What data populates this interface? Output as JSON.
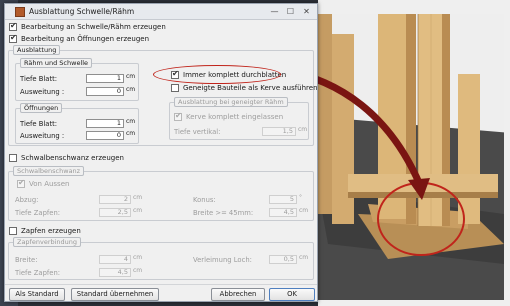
{
  "window": {
    "title": "Ausblattung Schwelle/Rähm",
    "minimize": "—",
    "maximize": "☐",
    "close": "✕"
  },
  "top": {
    "bearbeitung_schwelle": "Bearbeitung an Schwelle/Rähm erzeugen",
    "bearbeitung_oeffnungen": "Bearbeitung an Öffnungen erzeugen"
  },
  "ausblattung": {
    "title": "Ausblattung",
    "raehm": {
      "title": "Rähm und Schwelle",
      "tiefe_label": "Tiefe Blatt:",
      "tiefe_value": "1",
      "ausweitung_label": "Ausweitung :",
      "ausweitung_value": "0",
      "unit": "cm"
    },
    "oeffnungen": {
      "title": "Öffnungen",
      "tiefe_label": "Tiefe Blatt:",
      "tiefe_value": "1",
      "ausweitung_label": "Ausweitung :",
      "ausweitung_value": "0",
      "unit": "cm"
    },
    "immer_komplett": "Immer komplett durchblatten",
    "geneigte_bauteile": "Geneigte Bauteile als Kerve ausführen",
    "geneigter_raehm": {
      "title": "Ausblattung bei geneigter Rähm",
      "kerve_label": "Kerve komplett eingelassen",
      "tiefe_label": "Tiefe vertikal:",
      "tiefe_value": "1,5",
      "unit": "cm"
    }
  },
  "schwalbenschwanz": {
    "checkbox": "Schwalbenschwanz erzeugen",
    "group": "Schwalbenschwanz",
    "von_aussen": "Von Aussen",
    "abzug_label": "Abzug:",
    "abzug_value": "2",
    "konus_label": "Konus:",
    "konus_value": "5",
    "tiefe_zapfen_label": "Tiefe Zapfen:",
    "tiefe_zapfen_value": "2,5",
    "breite_label": "Breite >= 45mm:",
    "breite_value": "4,5",
    "unit_cm": "cm",
    "unit_deg": "°"
  },
  "zapfen": {
    "checkbox": "Zapfen erzeugen",
    "group": "Zapfenverbindung",
    "breite_label": "Breite:",
    "breite_value": "4",
    "verleimung_label": "Verleimung Loch:",
    "verleimung_value": "0,5",
    "tiefe_label": "Tiefe Zapfen:",
    "tiefe_value": "4,5",
    "unit": "cm"
  },
  "buttons": {
    "standard": "Als Standard",
    "uebernehmen": "Standard übernehmen",
    "abbrechen": "Abbrechen",
    "ok": "OK"
  },
  "colors": {
    "callout": "#c0241b",
    "arrow": "#7a1512",
    "timber": "#d9b27a"
  }
}
